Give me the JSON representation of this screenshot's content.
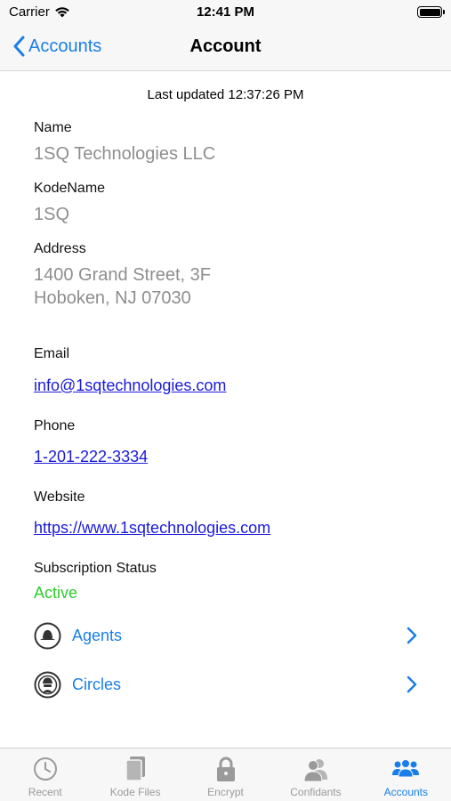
{
  "status_bar": {
    "carrier": "Carrier",
    "time": "12:41 PM"
  },
  "nav": {
    "back_label": "Accounts",
    "title": "Account"
  },
  "last_updated": "Last updated 12:37:26 PM",
  "fields": {
    "name": {
      "label": "Name",
      "value": "1SQ Technologies LLC"
    },
    "kodename": {
      "label": "KodeName",
      "value": "1SQ"
    },
    "address": {
      "label": "Address",
      "line1": "1400 Grand Street, 3F",
      "line2": "Hoboken, NJ 07030"
    },
    "email": {
      "label": "Email",
      "value": "info@1sqtechnologies.com"
    },
    "phone": {
      "label": "Phone",
      "value": "1-201-222-3334"
    },
    "website": {
      "label": "Website",
      "value": "https://www.1sqtechnologies.com"
    },
    "subscription": {
      "label": "Subscription Status",
      "value": "Active"
    }
  },
  "rows": [
    {
      "label": "Agents",
      "icon": "agent-icon"
    },
    {
      "label": "Circles",
      "icon": "circle-agent-icon"
    }
  ],
  "tabs": [
    {
      "label": "Recent",
      "icon": "clock-icon",
      "active": false
    },
    {
      "label": "Kode Files",
      "icon": "files-icon",
      "active": false
    },
    {
      "label": "Encrypt",
      "icon": "lock-icon",
      "active": false
    },
    {
      "label": "Confidants",
      "icon": "confidants-icon",
      "active": false
    },
    {
      "label": "Accounts",
      "icon": "accounts-icon",
      "active": true
    }
  ],
  "colors": {
    "accent": "#1a7ee8",
    "link": "#1a1adb",
    "active_status": "#2ecc2e",
    "muted_value": "#8e8e8e",
    "inactive_tab": "#9a9a9a"
  }
}
